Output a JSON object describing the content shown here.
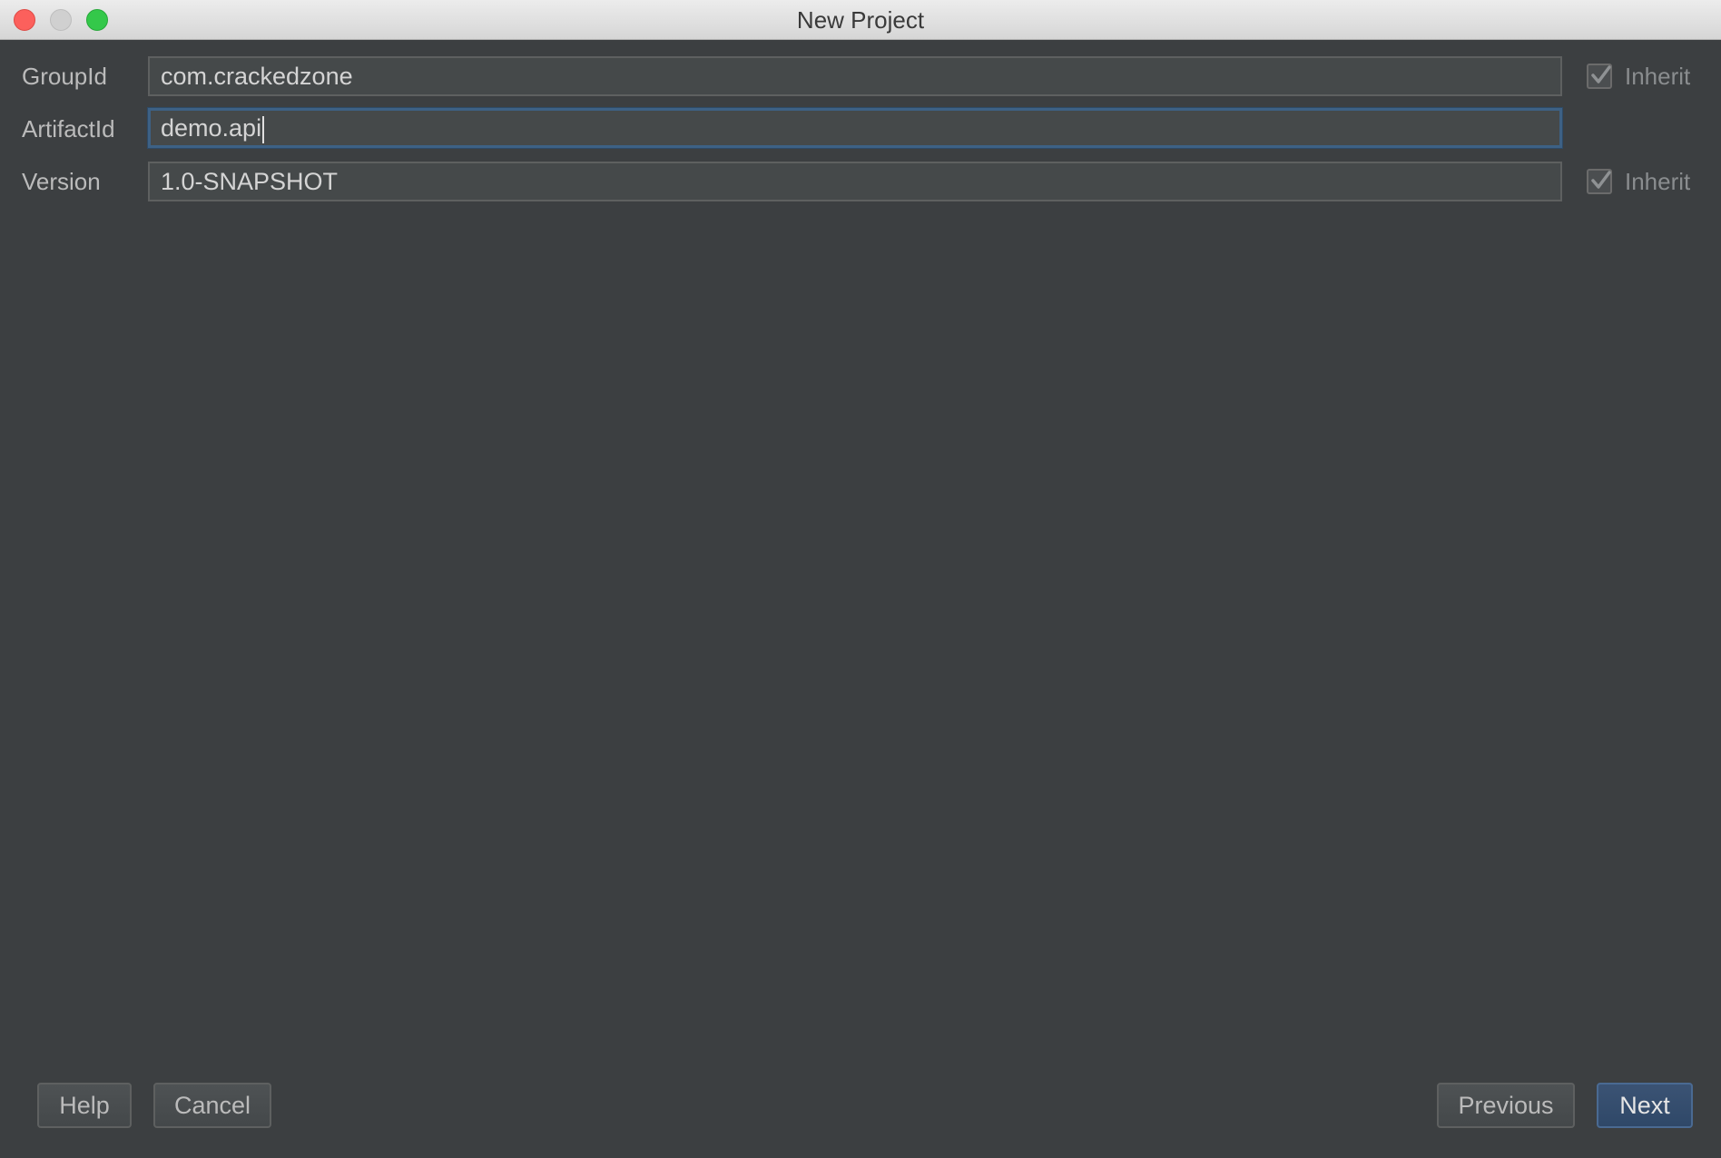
{
  "window": {
    "title": "New Project",
    "traffic_lights": [
      "close",
      "minimize",
      "maximize"
    ]
  },
  "form": {
    "group_id": {
      "label": "GroupId",
      "value": "com.crackedzone",
      "inherit_label": "Inherit",
      "inherit_checked": true
    },
    "artifact_id": {
      "label": "ArtifactId",
      "value": "demo.api"
    },
    "version": {
      "label": "Version",
      "value": "1.0-SNAPSHOT",
      "inherit_label": "Inherit",
      "inherit_checked": true
    }
  },
  "buttons": {
    "help": "Help",
    "cancel": "Cancel",
    "previous": "Previous",
    "next": "Next"
  },
  "colors": {
    "background": "#3c3f41",
    "field": "#45494a",
    "focus_border": "#3d6185",
    "default_button": "#2f4868"
  }
}
